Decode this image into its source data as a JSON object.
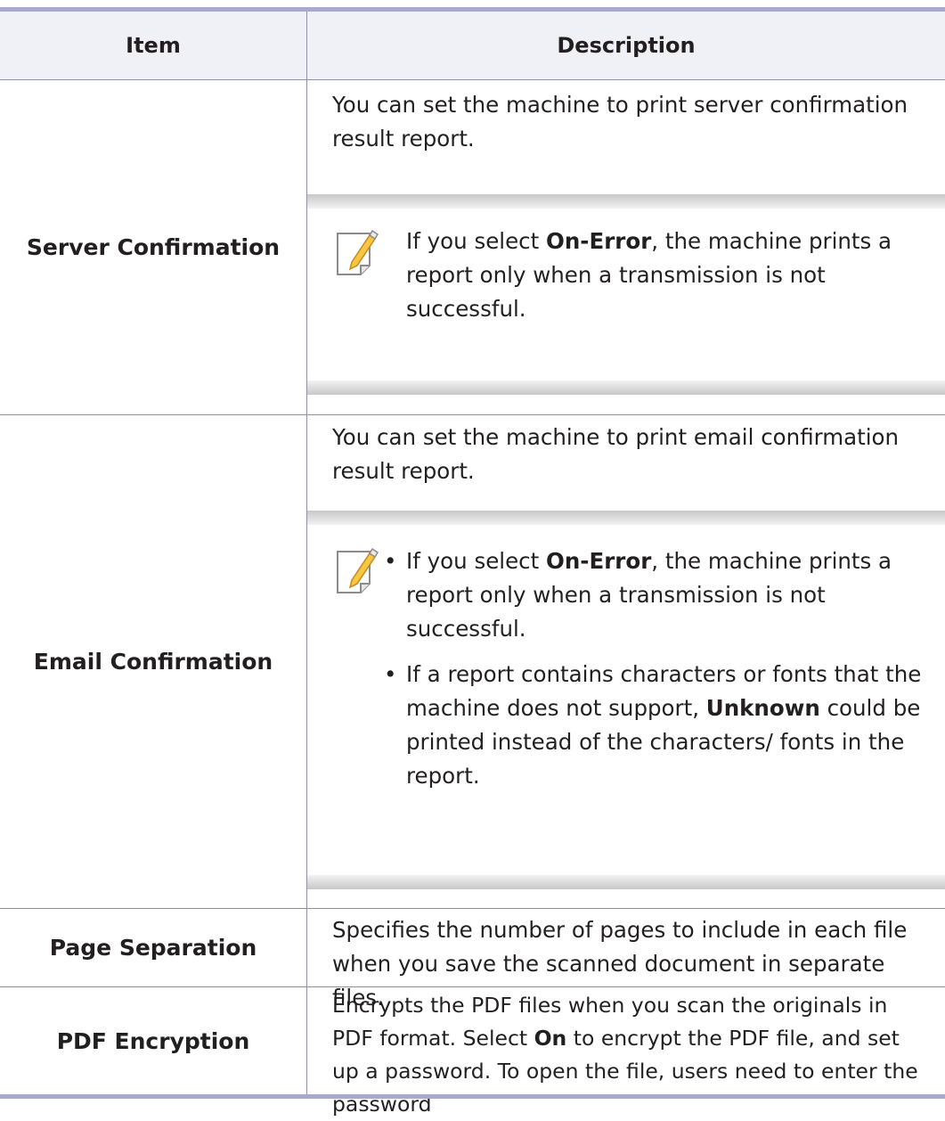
{
  "table": {
    "headers": {
      "item": "Item",
      "description": "Description"
    },
    "rows": [
      {
        "item": "Server Confirmation",
        "description": "You can set the machine to print server confirmation result report.",
        "note": {
          "icon": "note-pencil-icon",
          "pre": "If you select ",
          "bold": "On-Error",
          "post": ", the machine prints a report only when a transmission is not successful."
        }
      },
      {
        "item": "Email Confirmation",
        "description": "You can set the machine to print email confirmation result report.",
        "note": {
          "icon": "note-pencil-icon",
          "bullets": [
            {
              "pre": "If you select ",
              "bold": "On-Error",
              "post": ", the machine prints a report only when a transmission is not successful."
            },
            {
              "pre": "If a report contains characters or fonts that the machine does not support, ",
              "bold": "Unknown",
              "post": " could be printed instead of the characters/ fonts in the report."
            }
          ]
        }
      },
      {
        "item": "Page Separation",
        "description": "Specifies the number of pages to include in each file when you save the scanned document in separate files."
      },
      {
        "item": "PDF Encryption",
        "description_pre": "Encrypts the PDF files when you scan the originals in PDF format. Select ",
        "description_bold": "On",
        "description_post": " to encrypt the PDF file, and set up a password. To open the file, users need to enter the password"
      }
    ]
  },
  "bullet_char": "•",
  "colors": {
    "header_bg": "#f0f0f7",
    "rule": "#a8a9cf",
    "grid": "#8f90a8",
    "text": "#231f20",
    "note_icon_fill": "#f6c744"
  }
}
